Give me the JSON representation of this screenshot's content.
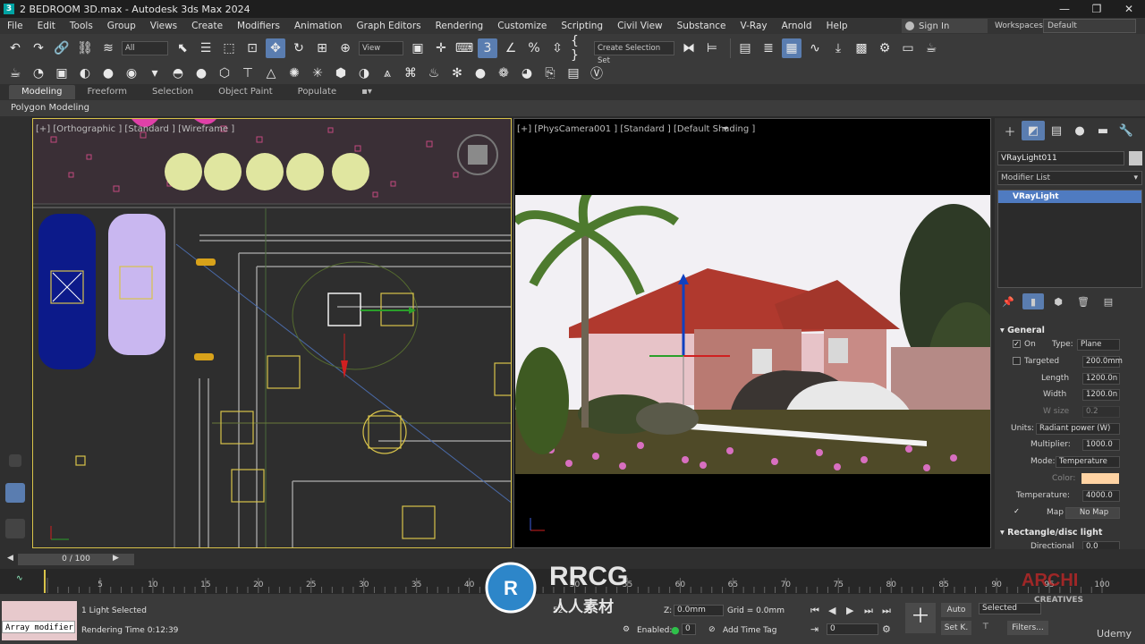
{
  "window": {
    "title": "2 BEDROOM 3D.max - Autodesk 3ds Max 2024",
    "controls": [
      "—",
      "❐",
      "✕"
    ]
  },
  "menu": [
    "File",
    "Edit",
    "Tools",
    "Group",
    "Views",
    "Create",
    "Modifiers",
    "Animation",
    "Graph Editors",
    "Rendering",
    "Customize",
    "Scripting",
    "Civil View",
    "Substance",
    "V-Ray",
    "Arnold",
    "Help"
  ],
  "account": {
    "signin": "Sign In",
    "workspaces_label": "Workspaces:",
    "workspace": "Default"
  },
  "toolbar": {
    "filter_select": "All",
    "ref_coord_select": "View",
    "selection_set": "Create Selection Set"
  },
  "ribbon": {
    "tabs": [
      "Modeling",
      "Freeform",
      "Selection",
      "Object Paint",
      "Populate"
    ],
    "active_tab": "Modeling",
    "panel_label": "Polygon Modeling"
  },
  "viewports": {
    "left_label": "[+] [Orthographic ] [Standard ] [Wireframe ]",
    "right_label": "[+] [PhysCamera001 ] [Standard ] [Default Shading ]"
  },
  "command_panel": {
    "object_name": "VRayLight011",
    "modifier_list": "Modifier List",
    "stack_item": "VRayLight",
    "general": {
      "title": "General",
      "on_label": "On",
      "on_checked": true,
      "type_label": "Type:",
      "type_value": "Plane",
      "targeted_label": "Targeted",
      "targeted_value": "200.0mm",
      "length_label": "Length",
      "length_value": "1200.0n",
      "width_label": "Width",
      "width_value": "1200.0n",
      "wsize_label": "W size",
      "wsize_value": "0.2",
      "units_label": "Units:",
      "units_value": "Radiant power (W)",
      "multiplier_label": "Multiplier:",
      "multiplier_value": "1000.0",
      "mode_label": "Mode:",
      "mode_value": "Temperature",
      "color_label": "Color:",
      "color_swatch": "#ffd3a3",
      "temperature_label": "Temperature:",
      "temperature_value": "4000.0",
      "map_label": "Map",
      "map_value": "No Map"
    },
    "rect_title": "Rectangle/disc light",
    "directional_label": "Directional",
    "directional_value": "0.0"
  },
  "timeline": {
    "slider_text": "0 / 100",
    "ticks": [
      "5",
      "10",
      "15",
      "20",
      "25",
      "30",
      "35",
      "40",
      "45",
      "50",
      "55",
      "60",
      "65",
      "70",
      "75",
      "80",
      "85",
      "90",
      "95",
      "100"
    ]
  },
  "status": {
    "script_text": "Array modifier",
    "selection_text": "1 Light Selected",
    "render_time": "Rendering Time  0:12:39",
    "partial_field": "52",
    "z_label": "Z:",
    "z_value": "0.0mm",
    "grid_text": "Grid = 0.0mm",
    "enabled_label": "Enabled:",
    "enabled_value": "0",
    "add_time_tag": "Add Time Tag",
    "frame_value": "0",
    "auto_label": "Auto",
    "setk_label": "Set K.",
    "selected_value": "Selected",
    "filters_label": "Filters..."
  },
  "watermarks": {
    "rrcg": "RRCG",
    "rrcg_cn": "人人素材",
    "archi": "ARCHI",
    "archi_sub": "CREATIVES",
    "udemy": "Udemy"
  }
}
